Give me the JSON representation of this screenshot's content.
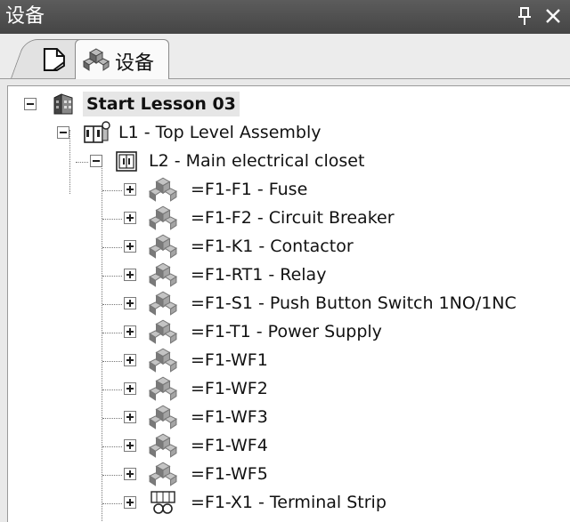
{
  "window": {
    "title": "设备",
    "pin_glyph": "ф",
    "close_glyph": "✕"
  },
  "tabs": [
    {
      "label": "",
      "icon": "page-icon"
    },
    {
      "label": "设备",
      "icon": "device-icon"
    }
  ],
  "tree": {
    "root": {
      "label": "Start Lesson 03",
      "icon": "building-icon"
    },
    "level1": {
      "label": "L1 - Top Level Assembly",
      "icon": "assembly-icon"
    },
    "level2": {
      "label": "L2 - Main electrical closet",
      "icon": "closet-icon"
    },
    "items": [
      {
        "label": "=F1-F1 - Fuse",
        "icon": "device-icon"
      },
      {
        "label": "=F1-F2 - Circuit Breaker",
        "icon": "device-icon"
      },
      {
        "label": "=F1-K1 - Contactor",
        "icon": "device-icon"
      },
      {
        "label": "=F1-RT1 - Relay",
        "icon": "device-icon"
      },
      {
        "label": "=F1-S1 - Push Button Switch 1NO/1NC",
        "icon": "device-icon"
      },
      {
        "label": "=F1-T1 - Power Supply",
        "icon": "device-icon"
      },
      {
        "label": "=F1-WF1",
        "icon": "device-icon"
      },
      {
        "label": "=F1-WF2",
        "icon": "device-icon"
      },
      {
        "label": "=F1-WF3",
        "icon": "device-icon"
      },
      {
        "label": "=F1-WF4",
        "icon": "device-icon"
      },
      {
        "label": "=F1-WF5",
        "icon": "device-icon"
      },
      {
        "label": "=F1-X1 - Terminal Strip",
        "icon": "terminal-strip-icon"
      }
    ]
  }
}
